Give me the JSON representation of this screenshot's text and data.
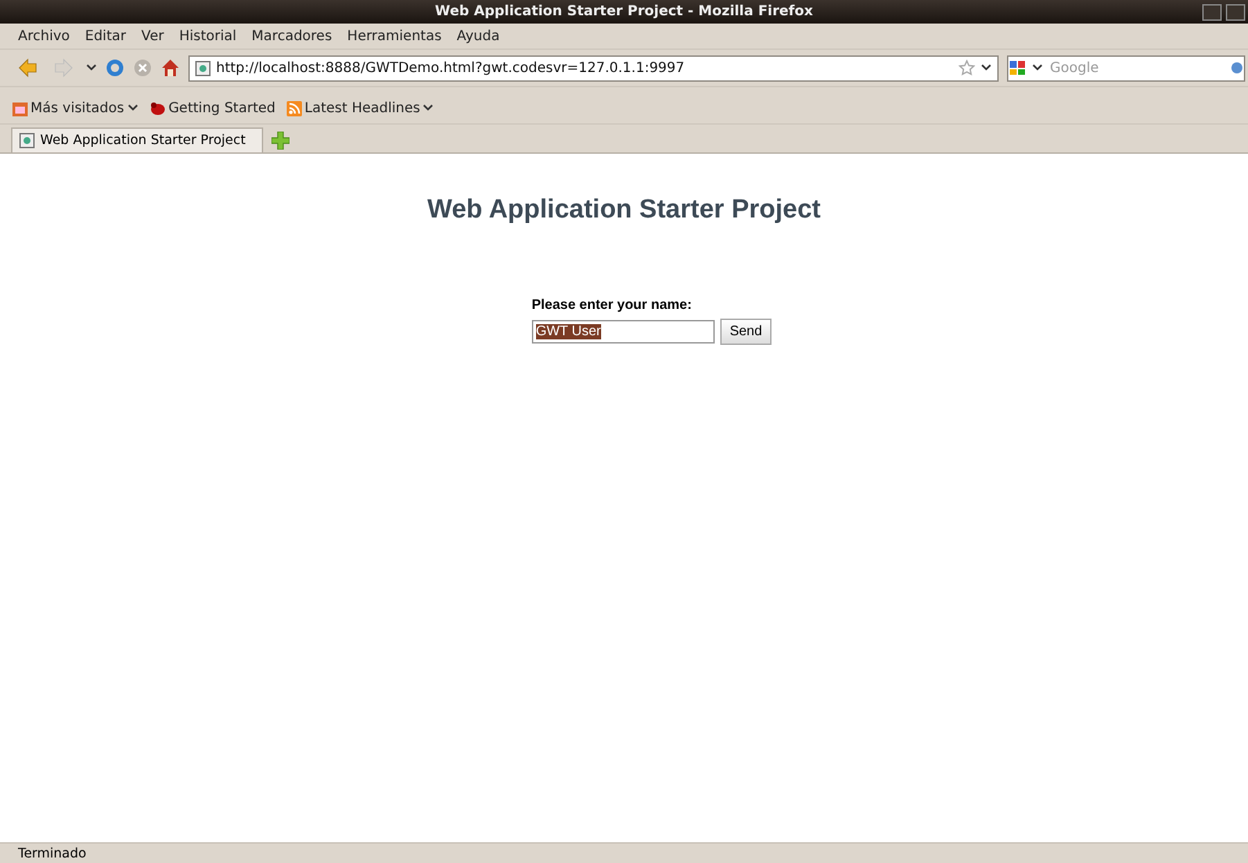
{
  "window": {
    "title": "Web Application Starter Project - Mozilla Firefox"
  },
  "menu": [
    "Archivo",
    "Editar",
    "Ver",
    "Historial",
    "Marcadores",
    "Herramientas",
    "Ayuda"
  ],
  "navigation": {
    "url": "http://localhost:8888/GWTDemo.html?gwt.codesvr=127.0.1.1:9997",
    "search_placeholder": "Google"
  },
  "bookmarks": [
    {
      "label": "Más visitados",
      "kind": "folder"
    },
    {
      "label": "Getting Started",
      "kind": "page"
    },
    {
      "label": "Latest Headlines",
      "kind": "feed"
    }
  ],
  "tabs": [
    {
      "label": "Web Application Starter Project",
      "selected": true
    }
  ],
  "page": {
    "heading": "Web Application Starter Project",
    "prompt": "Please enter your name:",
    "name_value": "GWT User",
    "text_selected": true,
    "button": "Send"
  },
  "status_bar": "Terminado"
}
